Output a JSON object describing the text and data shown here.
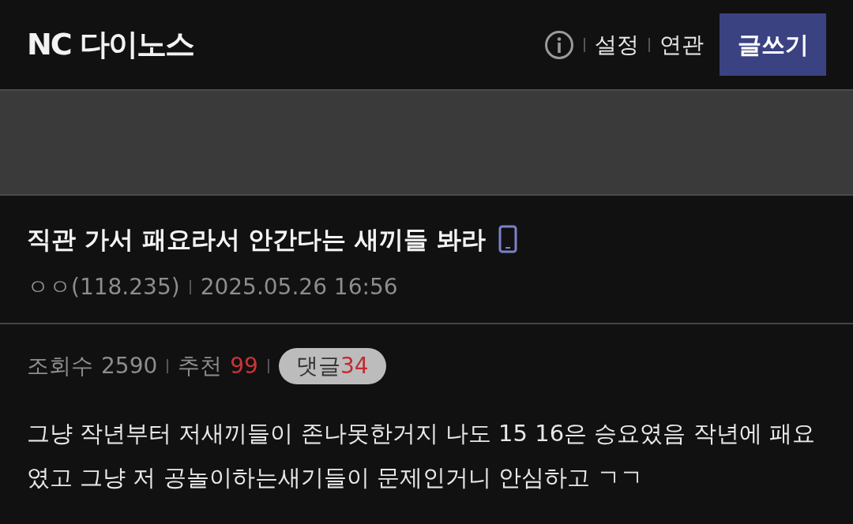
{
  "header": {
    "title": "NC 다이노스",
    "links": [
      "설정",
      "연관"
    ],
    "write_button": "글쓰기"
  },
  "post": {
    "title": "직관 가서 패요라서 안간다는 새끼들 봐라",
    "author": "ㅇㅇ(118.235)",
    "date": "2025.05.26 16:56",
    "views_label": "조회수",
    "views": "2590",
    "recommend_label": "추천",
    "recommend": "99",
    "comments_label": "댓글",
    "comments": "34",
    "body": "그냥 작년부터 저새끼들이 존나못한거지 나도 15 16은 승요였음 작년에 패요였고 그냥 저 공놀이하는새기들이 문제인거니 안심하고 ㄱㄱ"
  }
}
